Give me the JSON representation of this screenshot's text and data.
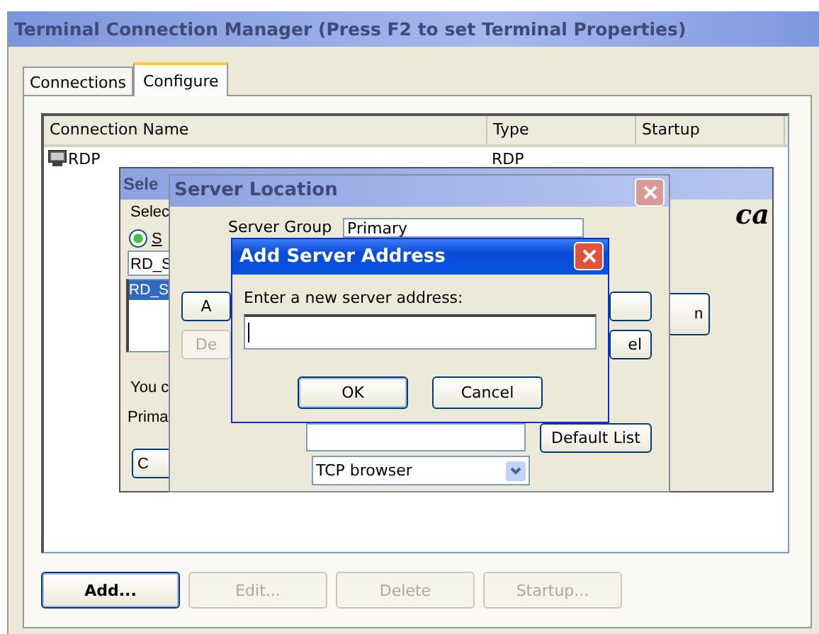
{
  "main_window": {
    "title": "Terminal Connection Manager (Press F2 to set Terminal Properties)",
    "active": false
  },
  "tabs": [
    {
      "label": "Connections",
      "selected": false
    },
    {
      "label": "Configure",
      "selected": true
    }
  ],
  "connections_table": {
    "columns": [
      "Connection Name",
      "Type",
      "Startup"
    ],
    "rows": [
      {
        "name": "RDP",
        "type": "RDP"
      }
    ]
  },
  "buttons": [
    {
      "label": "Add...",
      "disabled": false
    },
    {
      "label": "Edit...",
      "disabled": true
    },
    {
      "label": "Delete",
      "disabled": true
    },
    {
      "label": "Startup...",
      "disabled": true
    }
  ],
  "back_dialog": {
    "title": "Sele",
    "label": "Selec",
    "radio": {
      "label": "S",
      "selected": true
    },
    "field_value": "RD_S",
    "list_items": [
      {
        "label": "RD_S",
        "selected": true
      }
    ],
    "text_1": "You c",
    "text_2": "Prima",
    "left_button": "C",
    "right_button": "n",
    "logo_text": "ca"
  },
  "server_location": {
    "title": "Server Location",
    "group_label": "Server Group",
    "group_value": "Primary",
    "left_buttons": [
      {
        "label": "A",
        "disabled": false
      },
      {
        "label": "De",
        "disabled": true
      }
    ],
    "cancel_button": "el",
    "default_list_button": "Default List",
    "protocol_value": "TCP browser"
  },
  "add_server_dialog": {
    "title": "Add Server Address",
    "prompt": "Enter a new server address:",
    "ok": "OK",
    "cancel": "Cancel"
  }
}
